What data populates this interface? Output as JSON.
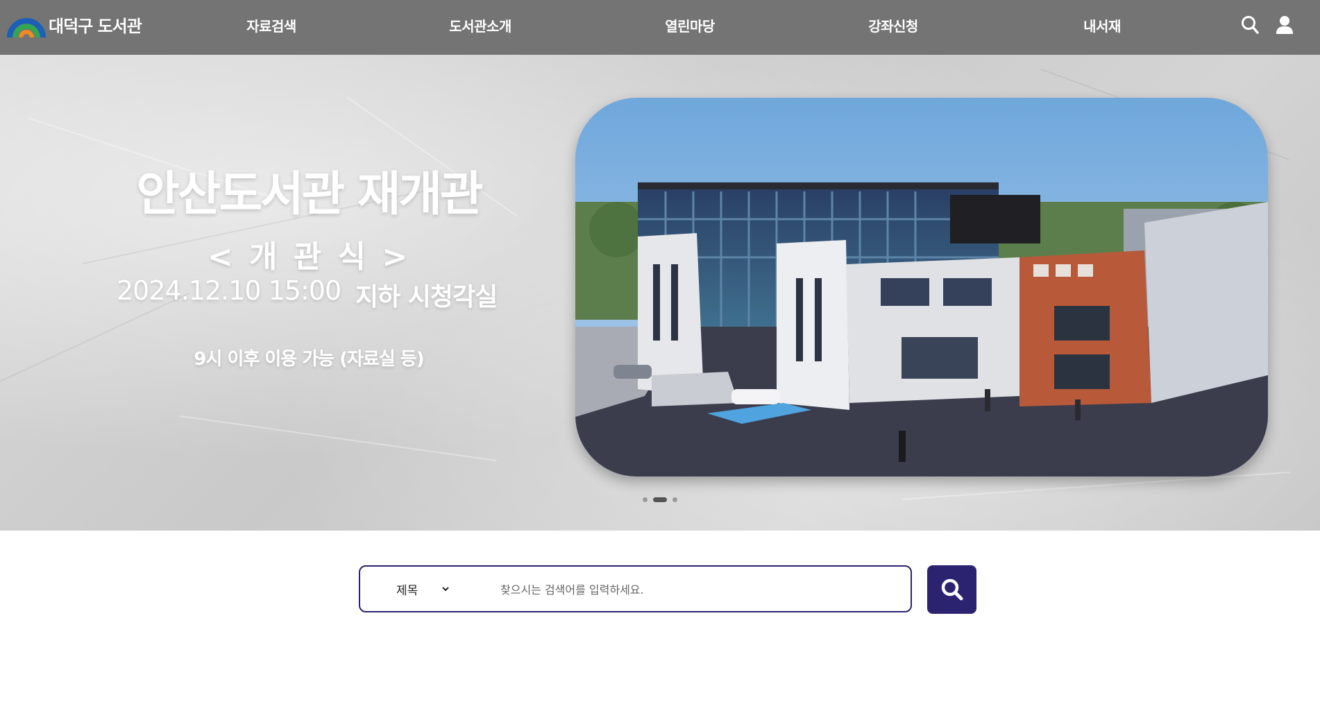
{
  "header": {
    "logo_text": "대덕구 도서관",
    "nav": [
      {
        "label": "자료검색"
      },
      {
        "label": "도서관소개"
      },
      {
        "label": "열린마당"
      },
      {
        "label": "강좌신청"
      },
      {
        "label": "내서재"
      }
    ],
    "icons": [
      "search-icon",
      "user-icon"
    ]
  },
  "hero": {
    "title": "안산도서관 재개관",
    "subtitle": "< 개 관 식 >",
    "datetime": "2024.12.10  15:00",
    "place": "지하 시청각실",
    "note": "9시 이후 이용 가능 (자료실 등)",
    "slides_total": 3,
    "active_slide": 2
  },
  "search": {
    "field_selected": "제목",
    "placeholder": "찾으시는 검색어를 입력하세요.",
    "button_icon": "search-icon"
  },
  "colors": {
    "header_bg": "#747474",
    "accent": "#2b2270",
    "logo_arc_blue": "#1b5fb8",
    "logo_arc_green": "#2fa84f",
    "logo_arc_orange": "#f08a24"
  }
}
